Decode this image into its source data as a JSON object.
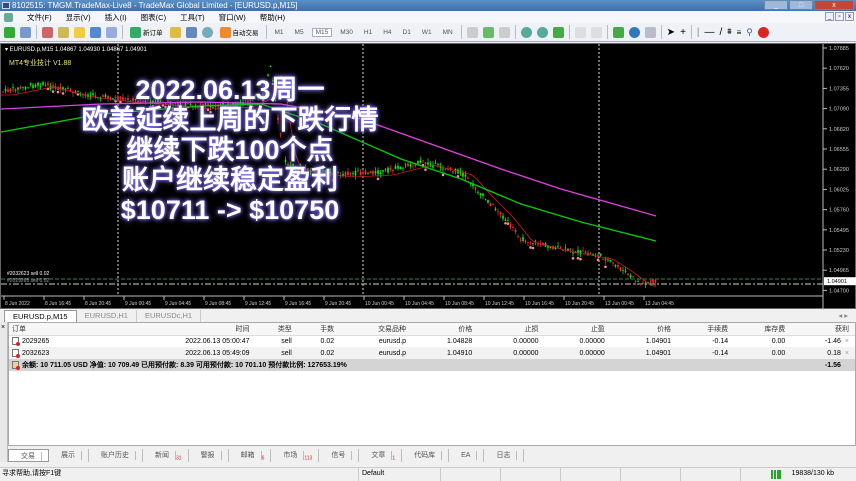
{
  "window": {
    "title": "8102515: TMGM.TradeMax-Live8 - TradeMax Global Limited - [EURUSD.p,M15]",
    "min": "_",
    "restore": "□",
    "close": "x"
  },
  "menu": [
    "文件(F)",
    "显示(V)",
    "插入(I)",
    "图表(C)",
    "工具(T)",
    "窗口(W)",
    "帮助(H)"
  ],
  "toolbar": {
    "new_order": "新订单",
    "auto_trading": "自动交易",
    "timeframes": [
      "M1",
      "M5",
      "M15",
      "M30",
      "H1",
      "H4",
      "D1",
      "W1",
      "MN"
    ],
    "selected_timeframe": "M15"
  },
  "chart": {
    "symbol_line": "▾ EURUSD.p,M15  1.04867 1.04930 1.04867 1.04901",
    "indicator": "MT4专业技计 V1.88",
    "price_labels": [
      "1.07885",
      "1.07620",
      "1.07355",
      "1.07090",
      "1.06820",
      "1.06555",
      "1.06290",
      "1.06025",
      "1.05760",
      "1.05495",
      "1.05230",
      "1.04965",
      "1.04700"
    ],
    "current_price": "1.04901",
    "time_labels": [
      "8 Jun 2022",
      "8 Jun 16:45",
      "8 Jun 20:45",
      "9 Jun 00:45",
      "9 Jun 04:45",
      "9 Jun 08:45",
      "9 Jun 12:45",
      "9 Jun 16:45",
      "9 Jun 20:45",
      "10 Jun 00:45",
      "10 Jun 04:45",
      "10 Jun 08:45",
      "10 Jun 12:45",
      "10 Jun 16:45",
      "10 Jun 20:45",
      "13 Jun 00:45",
      "13 Jun 04:45"
    ],
    "order_lines": [
      "#2032623 sell 0.02",
      "#2029265 sell 0.02"
    ],
    "overlay": [
      "2022.06.13周一",
      "欧美延续上周的下跌行情",
      "继续下跌100个点",
      "账户继续稳定盈利",
      "$10711 -> $10750"
    ],
    "colors": {
      "bull": "#00ff00",
      "bear": "#ff3030",
      "ma_fast": "#00d000",
      "ma_slow": "#e040e0",
      "ma_red": "#d02020"
    }
  },
  "chart_tabs": [
    "EURUSD.p,M15",
    "EURUSD,H1",
    "EURUSDc,H1"
  ],
  "terminal": {
    "headers": [
      "订单",
      "时间",
      "类型",
      "手数",
      "交易品种",
      "价格",
      "止损",
      "止盈",
      "价格",
      "手续费",
      "库存费",
      "获利"
    ],
    "rows": [
      [
        "2029265",
        "2022.06.13 05:00:47",
        "sell",
        "0.02",
        "eurusd.p",
        "1.04828",
        "0.00000",
        "0.00000",
        "1.04901",
        "-0.14",
        "0.00",
        "-1.46"
      ],
      [
        "2032623",
        "2022.06.13 05:49:09",
        "sell",
        "0.02",
        "eurusd.p",
        "1.04910",
        "0.00000",
        "0.00000",
        "1.04901",
        "-0.14",
        "0.00",
        "0.18"
      ]
    ],
    "balance_line": "余额: 10 711.05 USD  净值: 10 709.49  已用预付款: 8.39  可用预付款: 10 701.10  预付款比例: 127653.19%",
    "total_profit": "-1.56"
  },
  "bottom_tabs": [
    {
      "label": "交易"
    },
    {
      "label": "展示"
    },
    {
      "label": "账户历史"
    },
    {
      "label": "新闻",
      "badge": "31"
    },
    {
      "label": "警报"
    },
    {
      "label": "邮箱",
      "badge": "6"
    },
    {
      "label": "市场",
      "badge": "113"
    },
    {
      "label": "信号"
    },
    {
      "label": "文章",
      "badge": "1"
    },
    {
      "label": "代码库"
    },
    {
      "label": "EA"
    },
    {
      "label": "日志"
    }
  ],
  "status": {
    "help": "寻求帮助,请按F1键",
    "profile": "Default",
    "traffic": "19838/130 kb"
  }
}
